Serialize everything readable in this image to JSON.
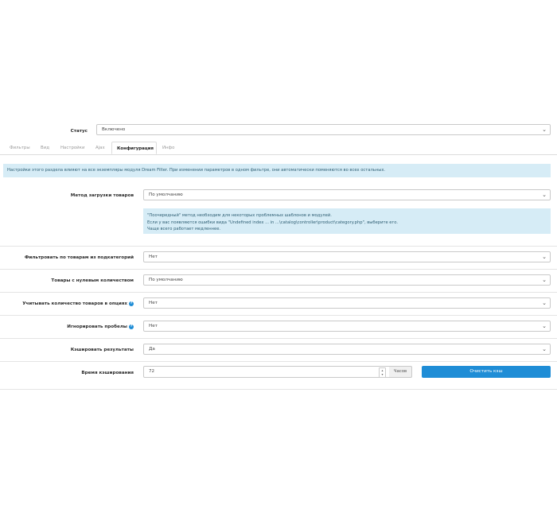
{
  "status": {
    "label": "Статус",
    "value": "Включено"
  },
  "tabs": [
    {
      "label": "Фильтры",
      "active": false
    },
    {
      "label": "Вид",
      "active": false
    },
    {
      "label": "Настройки",
      "active": false
    },
    {
      "label": "Ajax",
      "active": false
    },
    {
      "label": "Конфигурация",
      "active": true
    },
    {
      "label": "Инфо",
      "active": false
    }
  ],
  "notice": "Настройки этого раздела влияют на все экземпляры модуля Dream Filter. При изменении параметров в одном фильтре, они автоматически поменяются во всех остальных.",
  "load_method": {
    "label": "Метод загрузки товаров",
    "value": "По умолчанию",
    "hint_lines": [
      "\"Поочередный\" метод необходим для некоторых проблемных шаблонов и модулей.",
      "Если у вас появляются ошибки вида \"Undefined index ... in ...\\catalog\\controller\\product\\category.php\", выберите его.",
      "Чаще всего работает медленнее."
    ]
  },
  "fields": {
    "subcategories": {
      "label": "Фильтровать по товарам из подкатегорий",
      "value": "Нет"
    },
    "zero_qty": {
      "label": "Товары с нулевым количеством",
      "value": "По умолчанию"
    },
    "option_qty": {
      "label": "Учитывать количество товаров в опциях",
      "value": "Нет"
    },
    "ignore_spaces": {
      "label": "Игнорировать пробелы",
      "value": "Нет"
    },
    "cache_results": {
      "label": "Кэшировать результаты",
      "value": "Да"
    }
  },
  "cache_time": {
    "label": "Время кэширования",
    "value": "72",
    "unit": "Часов",
    "clear_button": "Очистить кэш"
  },
  "icons": {
    "dropdown": "chevron-down-icon",
    "help": "question-circle-icon",
    "spinner": "number-spinner-icon"
  },
  "colors": {
    "primary": "#1f8dd6",
    "info_bg": "#d6ecf6",
    "border": "#c9c9c9"
  }
}
